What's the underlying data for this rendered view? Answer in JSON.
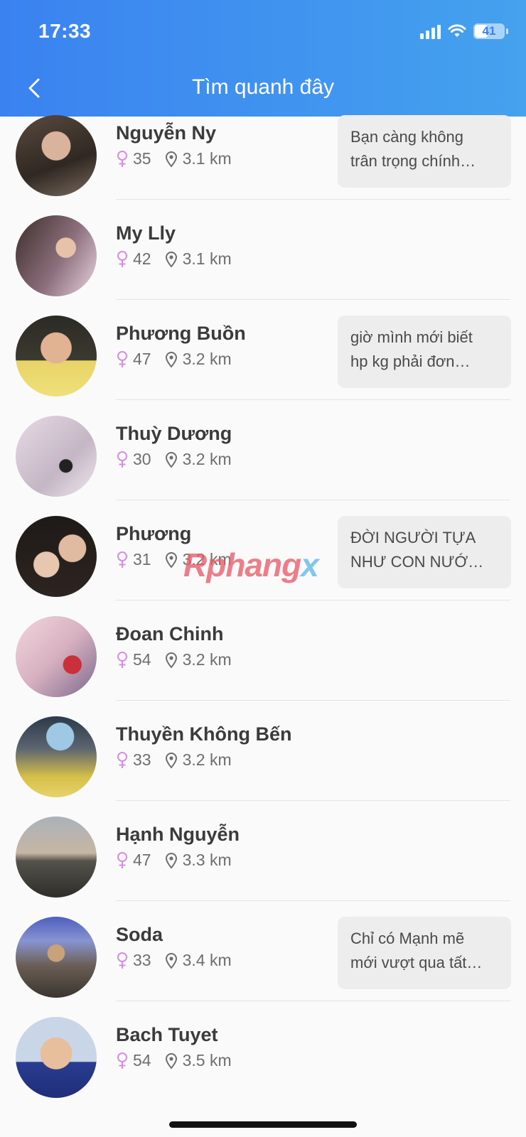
{
  "status_bar": {
    "time": "17:33",
    "battery": "41"
  },
  "header": {
    "title": "Tìm quanh đây"
  },
  "watermark": {
    "part1": "Rphang",
    "part2": "x"
  },
  "colors": {
    "header_start": "#3a82f0",
    "header_end": "#45a2ee",
    "female_icon": "#d98be8"
  },
  "users": [
    {
      "name": "Nguyễn Ny",
      "age": "35",
      "distance": "3.1 km",
      "status_line1": "Bạn càng không",
      "status_line2": "trân trọng chính…"
    },
    {
      "name": "My Lly",
      "age": "42",
      "distance": "3.1 km",
      "status_line1": "",
      "status_line2": ""
    },
    {
      "name": "Phương Buồn",
      "age": "47",
      "distance": "3.2 km",
      "status_line1": "giờ mình mới biết",
      "status_line2": "hp kg phải đơn…"
    },
    {
      "name": "Thuỳ Dương",
      "age": "30",
      "distance": "3.2 km",
      "status_line1": "",
      "status_line2": ""
    },
    {
      "name": "Phương",
      "age": "31",
      "distance": "3.2 km",
      "status_line1": "ĐỜI NGƯỜI TỰA",
      "status_line2": "NHƯ CON NƯỚ…"
    },
    {
      "name": "Đoan Chinh",
      "age": "54",
      "distance": "3.2 km",
      "status_line1": "",
      "status_line2": ""
    },
    {
      "name": "Thuyền Không Bến",
      "age": "33",
      "distance": "3.2 km",
      "status_line1": "",
      "status_line2": ""
    },
    {
      "name": "Hạnh Nguyễn",
      "age": "47",
      "distance": "3.3 km",
      "status_line1": "",
      "status_line2": ""
    },
    {
      "name": "Soda",
      "age": "33",
      "distance": "3.4 km",
      "status_line1": "Chỉ có Mạnh mẽ",
      "status_line2": "mới vượt qua tất…"
    },
    {
      "name": "Bach Tuyet",
      "age": "54",
      "distance": "3.5 km",
      "status_line1": "",
      "status_line2": ""
    }
  ]
}
